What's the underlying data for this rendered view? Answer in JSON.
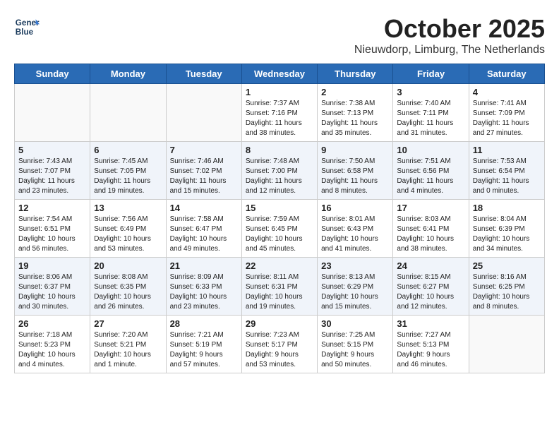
{
  "header": {
    "logo_line1": "General",
    "logo_line2": "Blue",
    "month": "October 2025",
    "location": "Nieuwdorp, Limburg, The Netherlands"
  },
  "weekdays": [
    "Sunday",
    "Monday",
    "Tuesday",
    "Wednesday",
    "Thursday",
    "Friday",
    "Saturday"
  ],
  "weeks": [
    [
      {
        "day": "",
        "info": ""
      },
      {
        "day": "",
        "info": ""
      },
      {
        "day": "",
        "info": ""
      },
      {
        "day": "1",
        "info": "Sunrise: 7:37 AM\nSunset: 7:16 PM\nDaylight: 11 hours\nand 38 minutes."
      },
      {
        "day": "2",
        "info": "Sunrise: 7:38 AM\nSunset: 7:13 PM\nDaylight: 11 hours\nand 35 minutes."
      },
      {
        "day": "3",
        "info": "Sunrise: 7:40 AM\nSunset: 7:11 PM\nDaylight: 11 hours\nand 31 minutes."
      },
      {
        "day": "4",
        "info": "Sunrise: 7:41 AM\nSunset: 7:09 PM\nDaylight: 11 hours\nand 27 minutes."
      }
    ],
    [
      {
        "day": "5",
        "info": "Sunrise: 7:43 AM\nSunset: 7:07 PM\nDaylight: 11 hours\nand 23 minutes."
      },
      {
        "day": "6",
        "info": "Sunrise: 7:45 AM\nSunset: 7:05 PM\nDaylight: 11 hours\nand 19 minutes."
      },
      {
        "day": "7",
        "info": "Sunrise: 7:46 AM\nSunset: 7:02 PM\nDaylight: 11 hours\nand 15 minutes."
      },
      {
        "day": "8",
        "info": "Sunrise: 7:48 AM\nSunset: 7:00 PM\nDaylight: 11 hours\nand 12 minutes."
      },
      {
        "day": "9",
        "info": "Sunrise: 7:50 AM\nSunset: 6:58 PM\nDaylight: 11 hours\nand 8 minutes."
      },
      {
        "day": "10",
        "info": "Sunrise: 7:51 AM\nSunset: 6:56 PM\nDaylight: 11 hours\nand 4 minutes."
      },
      {
        "day": "11",
        "info": "Sunrise: 7:53 AM\nSunset: 6:54 PM\nDaylight: 11 hours\nand 0 minutes."
      }
    ],
    [
      {
        "day": "12",
        "info": "Sunrise: 7:54 AM\nSunset: 6:51 PM\nDaylight: 10 hours\nand 56 minutes."
      },
      {
        "day": "13",
        "info": "Sunrise: 7:56 AM\nSunset: 6:49 PM\nDaylight: 10 hours\nand 53 minutes."
      },
      {
        "day": "14",
        "info": "Sunrise: 7:58 AM\nSunset: 6:47 PM\nDaylight: 10 hours\nand 49 minutes."
      },
      {
        "day": "15",
        "info": "Sunrise: 7:59 AM\nSunset: 6:45 PM\nDaylight: 10 hours\nand 45 minutes."
      },
      {
        "day": "16",
        "info": "Sunrise: 8:01 AM\nSunset: 6:43 PM\nDaylight: 10 hours\nand 41 minutes."
      },
      {
        "day": "17",
        "info": "Sunrise: 8:03 AM\nSunset: 6:41 PM\nDaylight: 10 hours\nand 38 minutes."
      },
      {
        "day": "18",
        "info": "Sunrise: 8:04 AM\nSunset: 6:39 PM\nDaylight: 10 hours\nand 34 minutes."
      }
    ],
    [
      {
        "day": "19",
        "info": "Sunrise: 8:06 AM\nSunset: 6:37 PM\nDaylight: 10 hours\nand 30 minutes."
      },
      {
        "day": "20",
        "info": "Sunrise: 8:08 AM\nSunset: 6:35 PM\nDaylight: 10 hours\nand 26 minutes."
      },
      {
        "day": "21",
        "info": "Sunrise: 8:09 AM\nSunset: 6:33 PM\nDaylight: 10 hours\nand 23 minutes."
      },
      {
        "day": "22",
        "info": "Sunrise: 8:11 AM\nSunset: 6:31 PM\nDaylight: 10 hours\nand 19 minutes."
      },
      {
        "day": "23",
        "info": "Sunrise: 8:13 AM\nSunset: 6:29 PM\nDaylight: 10 hours\nand 15 minutes."
      },
      {
        "day": "24",
        "info": "Sunrise: 8:15 AM\nSunset: 6:27 PM\nDaylight: 10 hours\nand 12 minutes."
      },
      {
        "day": "25",
        "info": "Sunrise: 8:16 AM\nSunset: 6:25 PM\nDaylight: 10 hours\nand 8 minutes."
      }
    ],
    [
      {
        "day": "26",
        "info": "Sunrise: 7:18 AM\nSunset: 5:23 PM\nDaylight: 10 hours\nand 4 minutes."
      },
      {
        "day": "27",
        "info": "Sunrise: 7:20 AM\nSunset: 5:21 PM\nDaylight: 10 hours\nand 1 minute."
      },
      {
        "day": "28",
        "info": "Sunrise: 7:21 AM\nSunset: 5:19 PM\nDaylight: 9 hours\nand 57 minutes."
      },
      {
        "day": "29",
        "info": "Sunrise: 7:23 AM\nSunset: 5:17 PM\nDaylight: 9 hours\nand 53 minutes."
      },
      {
        "day": "30",
        "info": "Sunrise: 7:25 AM\nSunset: 5:15 PM\nDaylight: 9 hours\nand 50 minutes."
      },
      {
        "day": "31",
        "info": "Sunrise: 7:27 AM\nSunset: 5:13 PM\nDaylight: 9 hours\nand 46 minutes."
      },
      {
        "day": "",
        "info": ""
      }
    ]
  ]
}
